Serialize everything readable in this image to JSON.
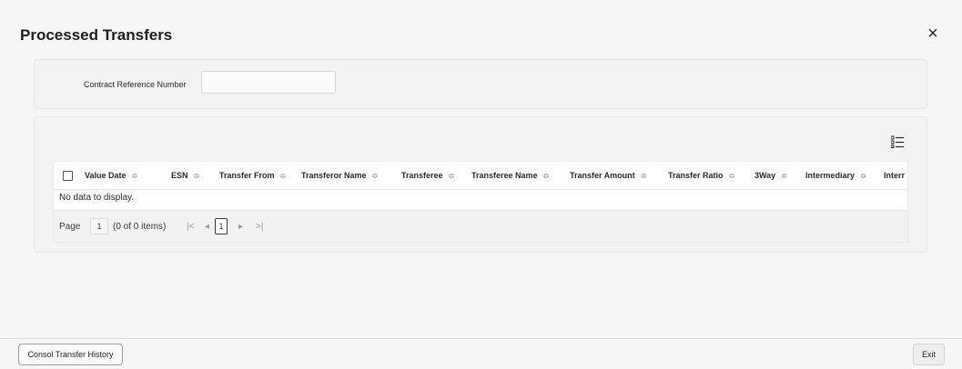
{
  "dialog": {
    "title": "Processed Transfers",
    "close_label": "×"
  },
  "filter": {
    "contract_ref_label": "Contract Reference Number",
    "contract_ref_value": ""
  },
  "grid": {
    "columns": [
      {
        "label": "Value Date",
        "sortable": true
      },
      {
        "label": "ESN",
        "sortable": true
      },
      {
        "label": "Transfer From",
        "sortable": true
      },
      {
        "label": "Transferor Name",
        "sortable": true
      },
      {
        "label": "Transferee",
        "sortable": true
      },
      {
        "label": "Transferee Name",
        "sortable": true
      },
      {
        "label": "Transfer Amount",
        "sortable": true
      },
      {
        "label": "Transfer Ratio",
        "sortable": true
      },
      {
        "label": "3Way",
        "sortable": true
      },
      {
        "label": "Intermediary",
        "sortable": true
      },
      {
        "label": "Interr",
        "sortable": false
      }
    ],
    "sort_glyph": "≎",
    "empty_text": "No data to display."
  },
  "pagination": {
    "page_label": "Page",
    "page_value": "1",
    "items_text": "(0 of 0 items)",
    "first_glyph": "|<",
    "prev_glyph": "◂",
    "current_page": "1",
    "next_glyph": "▸",
    "last_glyph": ">|"
  },
  "footer": {
    "consol_button": "Consol Transfer History",
    "exit_button": "Exit"
  }
}
